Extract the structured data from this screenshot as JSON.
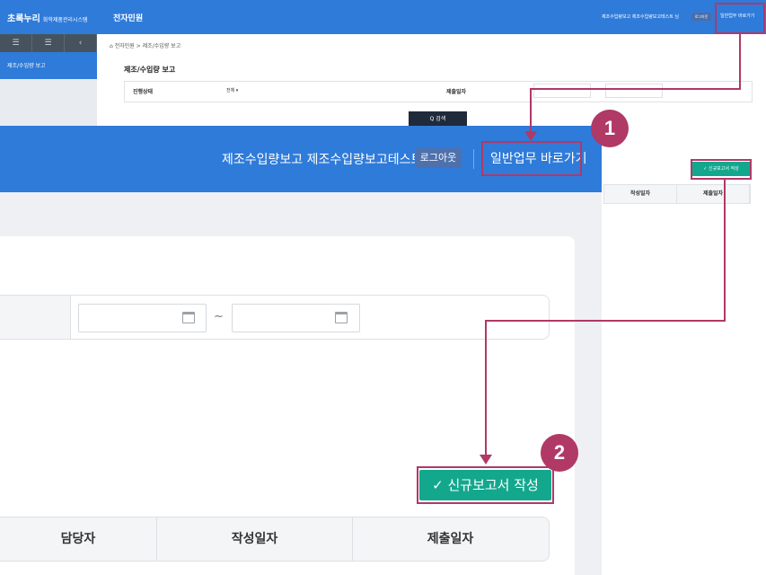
{
  "background": {
    "logo": "초록누리",
    "logo_sub": "화학제품관리시스템",
    "title": "전자민원",
    "user_text": "제조수입량보고 제조수입량보고테스트 님",
    "logout": "로그아웃",
    "goto": "일반업무 바로가기",
    "side_tools": [
      "☰",
      "☰",
      "‹"
    ],
    "side_item": "제조/수입량 보고",
    "breadcrumb_home": "⌂",
    "breadcrumb": "전자민원 > 제조/수입량 보고",
    "page_title": "제조/수입량 보고",
    "filter_status_label": "진행상태",
    "filter_status_value": "전체 ▾",
    "filter_date_label": "제출일자",
    "search_label": "Q 검색",
    "new_report_label": "✓ 신규보고서 작성",
    "columns": [
      "작성일자",
      "제출일자"
    ]
  },
  "zoom": {
    "user_text": "제조수입량보고 제조수입량보고테스트 님",
    "logout": "로그아웃",
    "goto": "일반업무 바로가기",
    "tilde": "~",
    "new_report_label": "✓ 신규보고서 작성",
    "columns": [
      "담당자",
      "작성일자",
      "제출일자"
    ]
  },
  "badges": [
    "1",
    "2"
  ],
  "colors": {
    "header_blue": "#2f7bd9",
    "accent_teal": "#13a88e",
    "callout": "#b03966"
  }
}
